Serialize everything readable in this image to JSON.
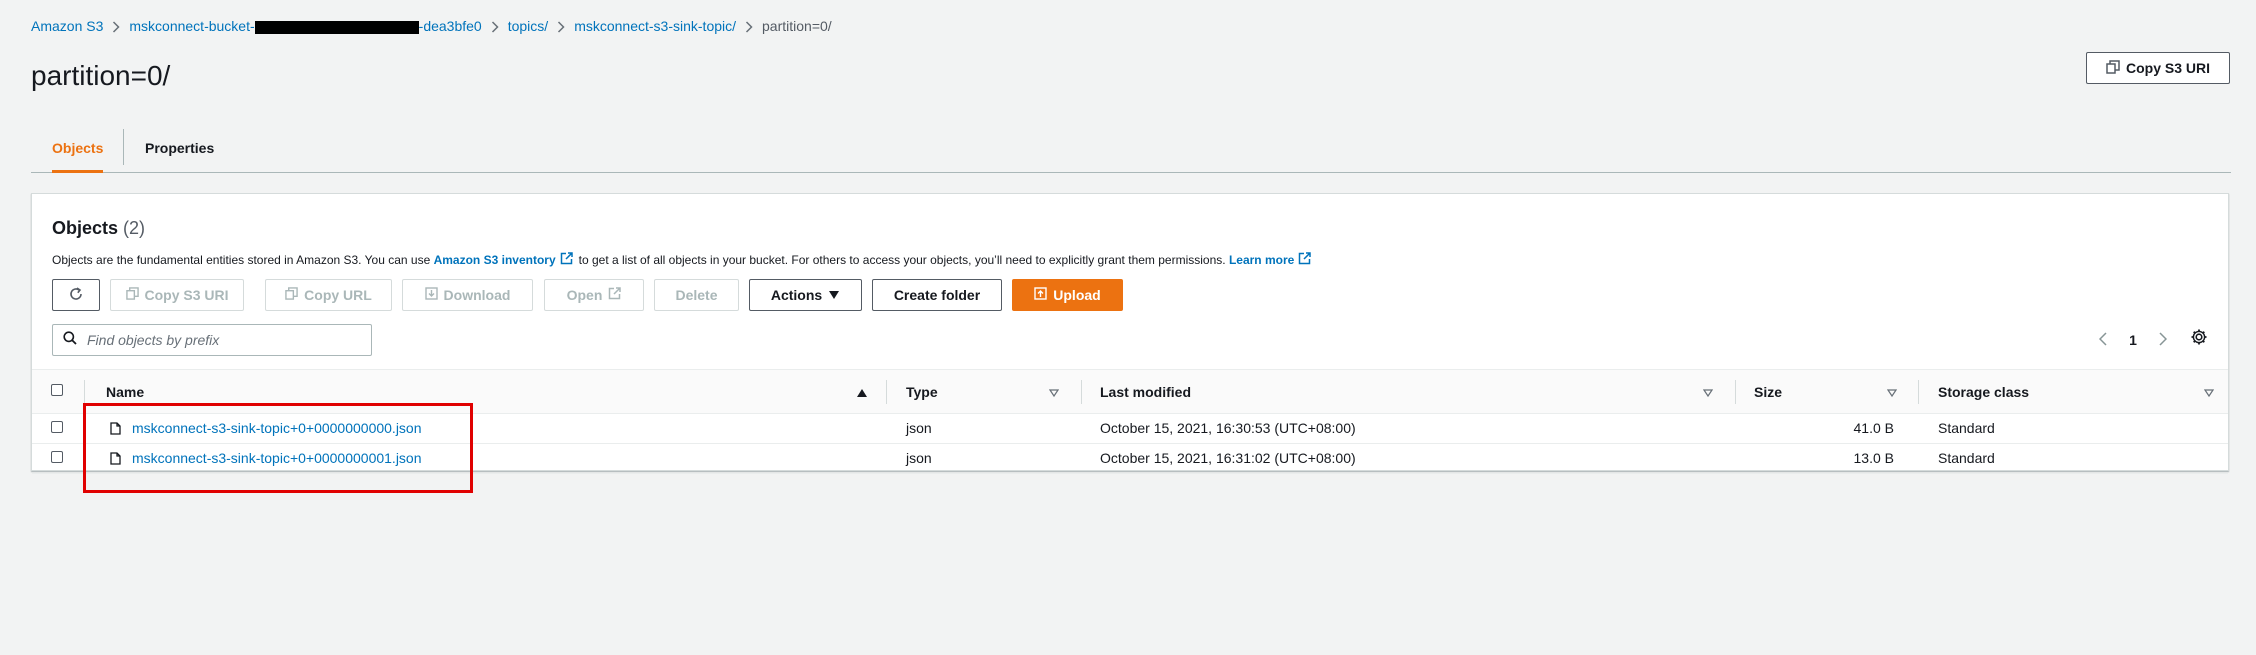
{
  "breadcrumb": {
    "items": [
      {
        "label": "Amazon S3"
      },
      {
        "label_start": "mskconnect-bucket-",
        "label_end": "-dea3bfe0"
      },
      {
        "label": "topics/"
      },
      {
        "label": "mskconnect-s3-sink-topic/"
      },
      {
        "label": "partition=0/"
      }
    ]
  },
  "page": {
    "title": "partition=0/",
    "copy_uri_label": "Copy S3 URI"
  },
  "tabs": [
    {
      "label": "Objects",
      "active": true
    },
    {
      "label": "Properties",
      "active": false
    }
  ],
  "objects_panel": {
    "title": "Objects",
    "count": "(2)",
    "description": {
      "before": "Objects are the fundamental entities stored in Amazon S3. You can use",
      "inventory_link": "Amazon S3 inventory",
      "middle": "to get a list of all objects in your bucket. For others to access your objects, you’ll need to explicitly grant them permissions.",
      "learn_more": "Learn more"
    },
    "toolbar": {
      "refresh_icon": "refresh-icon",
      "copy_s3_uri": "Copy S3 URI",
      "copy_url": "Copy URL",
      "download": "Download",
      "open": "Open",
      "delete": "Delete",
      "actions": "Actions",
      "create_folder": "Create folder",
      "upload": "Upload"
    },
    "search": {
      "placeholder": "Find objects by prefix"
    },
    "pagination": {
      "page": "1"
    },
    "table": {
      "columns": [
        "Name",
        "Type",
        "Last modified",
        "Size",
        "Storage class"
      ],
      "rows": [
        {
          "name": "mskconnect-s3-sink-topic+0+0000000000.json",
          "type": "json",
          "last_modified": "October 15, 2021, 16:30:53 (UTC+08:00)",
          "size": "41.0 B",
          "storage_class": "Standard"
        },
        {
          "name": "mskconnect-s3-sink-topic+0+0000000001.json",
          "type": "json",
          "last_modified": "October 15, 2021, 16:31:02 (UTC+08:00)",
          "size": "13.0 B",
          "storage_class": "Standard"
        }
      ]
    }
  },
  "colors": {
    "accent": "#ec7211",
    "link": "#0073bb",
    "highlight_box": "#e00000"
  }
}
